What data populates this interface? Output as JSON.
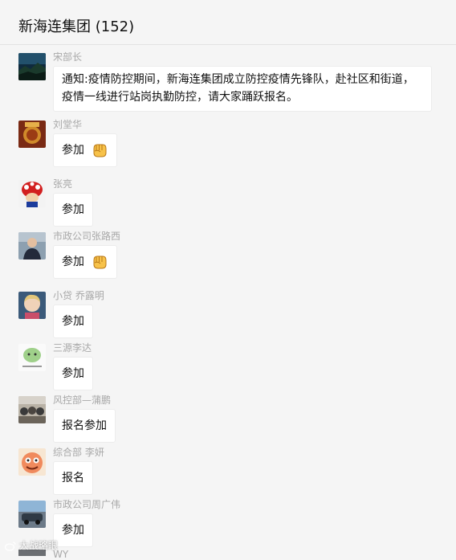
{
  "header": {
    "title": "新海连集团 (152)"
  },
  "messages": [
    {
      "sender": "宋部长",
      "text": "通知:疫情防控期间，新海连集团成立防控疫情先锋队，赴社区和街道，疫情一线进行站岗执勤防控，请大家踊跃报名。",
      "emoji": ""
    },
    {
      "sender": "刘堂华",
      "text": "参加",
      "emoji": "fist-emoji"
    },
    {
      "sender": "张亮",
      "text": "参加",
      "emoji": ""
    },
    {
      "sender": "市政公司张路西",
      "text": "参加",
      "emoji": "fist-emoji"
    },
    {
      "sender": "小贷   乔露明",
      "text": "参加",
      "emoji": ""
    },
    {
      "sender": "三源李达",
      "text": "参加",
      "emoji": ""
    },
    {
      "sender": "风控部—蒲鹏",
      "text": "报名参加",
      "emoji": ""
    },
    {
      "sender": "综合部 李妍",
      "text": "报名",
      "emoji": ""
    },
    {
      "sender": "市政公司周广伟",
      "text": "参加",
      "emoji": ""
    },
    {
      "sender": "WY",
      "text": "",
      "emoji": ""
    }
  ],
  "watermark": {
    "text": "大战略眼"
  },
  "colors": {
    "background": "#f5f5f5",
    "bubble": "#ffffff",
    "name": "#a8a8a8"
  }
}
